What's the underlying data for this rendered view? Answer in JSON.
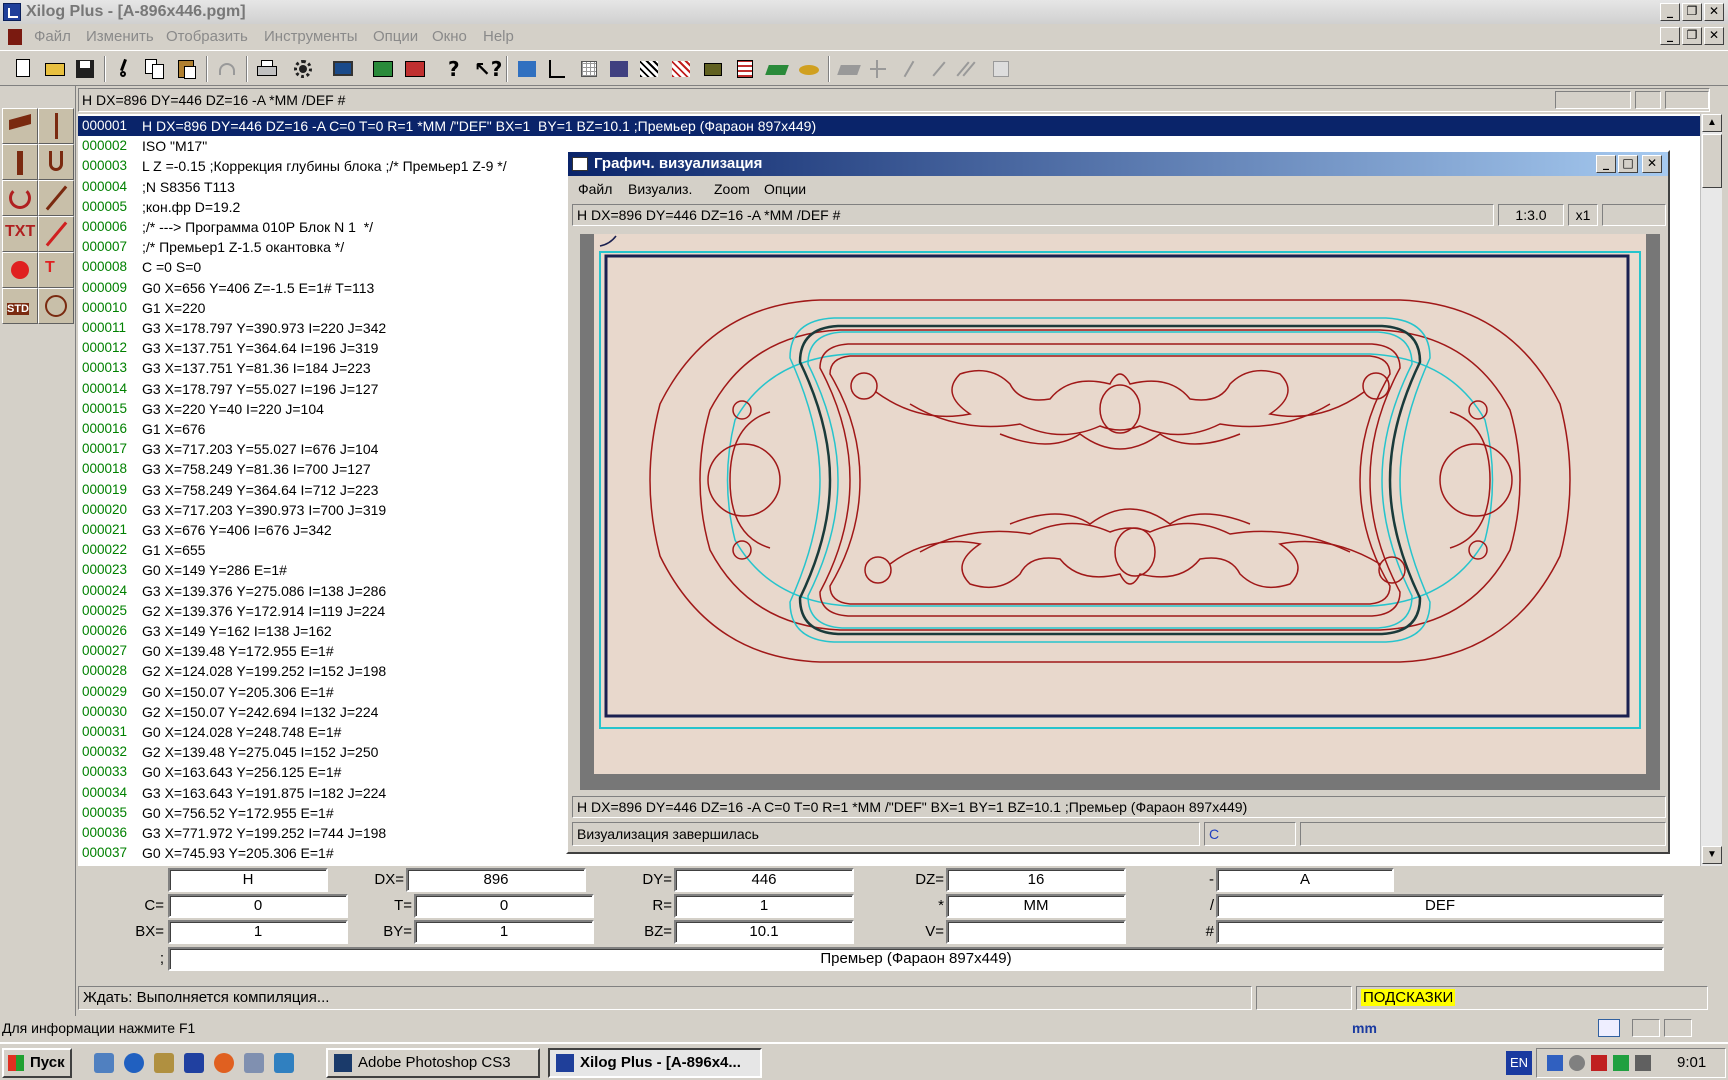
{
  "window": {
    "title": "Xilog Plus - [A-896x446.pgm]"
  },
  "menu": [
    "Файл",
    "Изменить",
    "Отобразить",
    "Инструменты",
    "Опции",
    "Окно",
    "Help"
  ],
  "header": {
    "text": "H DX=896 DY=446 DZ=16 -A *MM /DEF #"
  },
  "code": [
    {
      "n": "000001",
      "t": "H DX=896 DY=446 DZ=16 -A C=0 T=0 R=1 *MM /\"DEF\" BX=1  BY=1 BZ=10.1 ;Премьер (Фараон 897x449)"
    },
    {
      "n": "000002",
      "t": "ISO \"M17\""
    },
    {
      "n": "000003",
      "t": "L Z =-0.15 ;Коррекция глубины блока ;/* Премьер1 Z-9 */"
    },
    {
      "n": "000004",
      "t": ";N S8356 T113"
    },
    {
      "n": "000005",
      "t": ";кон.фр D=19.2"
    },
    {
      "n": "000006",
      "t": ";/* ---> Программа 010Р Блок N 1  */"
    },
    {
      "n": "000007",
      "t": ";/* Премьер1 Z-1.5 окантовка */"
    },
    {
      "n": "000008",
      "t": "C =0 S=0"
    },
    {
      "n": "000009",
      "t": "G0 X=656 Y=406 Z=-1.5 E=1# T=113"
    },
    {
      "n": "000010",
      "t": "G1 X=220"
    },
    {
      "n": "000011",
      "t": "G3 X=178.797 Y=390.973 I=220 J=342"
    },
    {
      "n": "000012",
      "t": "G3 X=137.751 Y=364.64 I=196 J=319"
    },
    {
      "n": "000013",
      "t": "G3 X=137.751 Y=81.36 I=184 J=223"
    },
    {
      "n": "000014",
      "t": "G3 X=178.797 Y=55.027 I=196 J=127"
    },
    {
      "n": "000015",
      "t": "G3 X=220 Y=40 I=220 J=104"
    },
    {
      "n": "000016",
      "t": "G1 X=676"
    },
    {
      "n": "000017",
      "t": "G3 X=717.203 Y=55.027 I=676 J=104"
    },
    {
      "n": "000018",
      "t": "G3 X=758.249 Y=81.36 I=700 J=127"
    },
    {
      "n": "000019",
      "t": "G3 X=758.249 Y=364.64 I=712 J=223"
    },
    {
      "n": "000020",
      "t": "G3 X=717.203 Y=390.973 I=700 J=319"
    },
    {
      "n": "000021",
      "t": "G3 X=676 Y=406 I=676 J=342"
    },
    {
      "n": "000022",
      "t": "G1 X=655"
    },
    {
      "n": "000023",
      "t": "G0 X=149 Y=286 E=1#"
    },
    {
      "n": "000024",
      "t": "G3 X=139.376 Y=275.086 I=138 J=286"
    },
    {
      "n": "000025",
      "t": "G2 X=139.376 Y=172.914 I=119 J=224"
    },
    {
      "n": "000026",
      "t": "G3 X=149 Y=162 I=138 J=162"
    },
    {
      "n": "000027",
      "t": "G0 X=139.48 Y=172.955 E=1#"
    },
    {
      "n": "000028",
      "t": "G2 X=124.028 Y=199.252 I=152 J=198"
    },
    {
      "n": "000029",
      "t": "G0 X=150.07 Y=205.306 E=1#"
    },
    {
      "n": "000030",
      "t": "G2 X=150.07 Y=242.694 I=132 J=224"
    },
    {
      "n": "000031",
      "t": "G0 X=124.028 Y=248.748 E=1#"
    },
    {
      "n": "000032",
      "t": "G2 X=139.48 Y=275.045 I=152 J=250"
    },
    {
      "n": "000033",
      "t": "G0 X=163.643 Y=256.125 E=1#"
    },
    {
      "n": "000034",
      "t": "G3 X=163.643 Y=191.875 I=182 J=224"
    },
    {
      "n": "000035",
      "t": "G0 X=756.52 Y=172.955 E=1#"
    },
    {
      "n": "000036",
      "t": "G3 X=771.972 Y=199.252 I=744 J=198"
    },
    {
      "n": "000037",
      "t": "G0 X=745.93 Y=205.306 E=1#"
    }
  ],
  "graph": {
    "title": "Графич. визуализация",
    "menu": [
      "Файл",
      "Визуализ.",
      "Zoom",
      "Опции"
    ],
    "info": "H DX=896 DY=446 DZ=16 -A *MM /DEF #",
    "scale": "1:3.0",
    "zoom": "x1",
    "footer": "H DX=896 DY=446 DZ=16 -A C=0 T=0 R=1 *MM /\"DEF\" BX=1  BY=1 BZ=10.1 ;Премьер (Фараон 897x449)",
    "status": "Визуализация завершилась",
    "status_code": "C"
  },
  "fields": {
    "H": "H",
    "DX_label": "DX=",
    "DX": "896",
    "DY_label": "DY=",
    "DY": "446",
    "DZ_label": "DZ=",
    "DZ": "16",
    "minus_label": "-",
    "minus": "A",
    "C_label": "C=",
    "C": "0",
    "T_label": "T=",
    "T": "0",
    "R_label": "R=",
    "R": "1",
    "star_label": "*",
    "star": "MM",
    "slash_label": "/",
    "slash": "DEF",
    "BX_label": "BX=",
    "BX": "1",
    "BY_label": "BY=",
    "BY": "1",
    "BZ_label": "BZ=",
    "BZ": "10.1",
    "V_label": "V=",
    "V": "",
    "hash_label": "#",
    "hash": "",
    "semi_label": ";",
    "semi": "Премьер (Фараон 897x449)"
  },
  "status": {
    "message": "Ждать: Выполняется компиляция...",
    "hints": "ПОДСКАЗКИ"
  },
  "help": {
    "text": "Для информации нажмите F1",
    "units": "mm"
  },
  "taskbar": {
    "start": "Пуск",
    "tasks": [
      "Adobe Photoshop CS3",
      "Xilog Plus - [A-896x4..."
    ],
    "lang": "EN",
    "clock": "9:01"
  },
  "colors": {
    "selection": "#0a246a",
    "line_numbers": "#008000",
    "part": "#e8d8cc",
    "contour": "#a01818",
    "tool_path": "#26c4cc",
    "hints_bg": "#ffff00"
  }
}
